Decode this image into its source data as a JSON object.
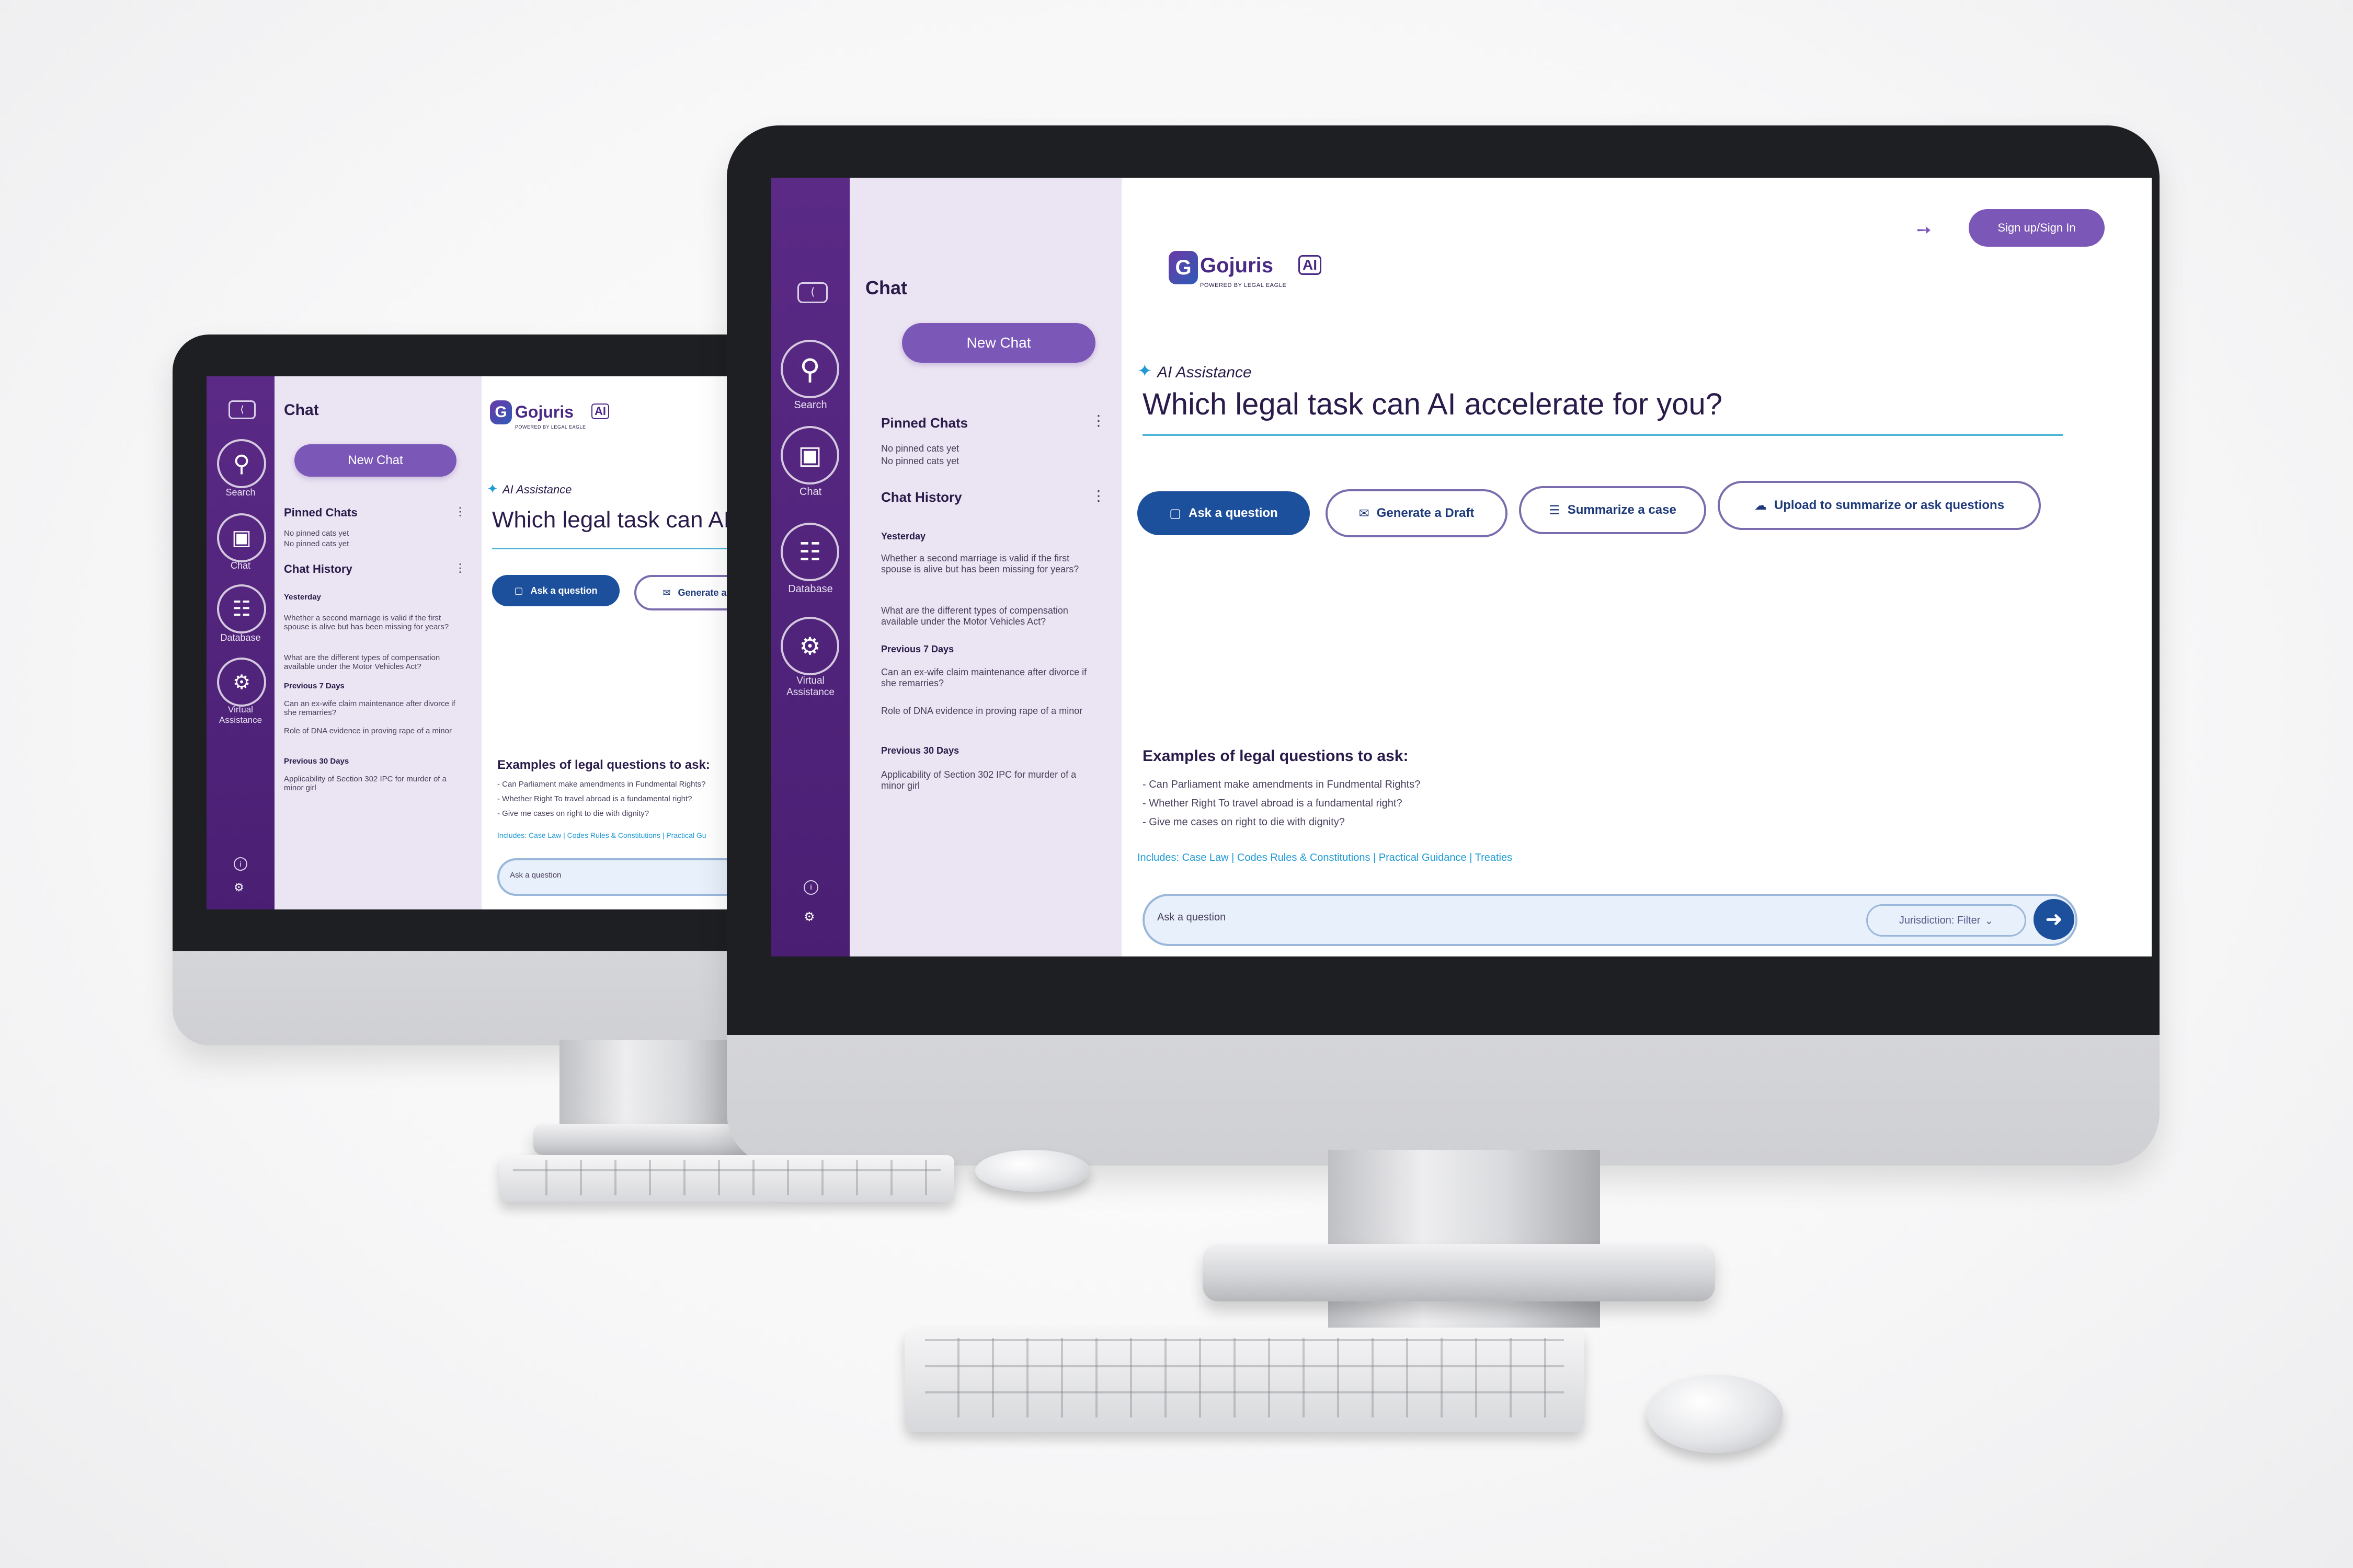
{
  "app": {
    "brand": "Gojuris",
    "brand_badge": "AI",
    "brand_sub": "POWERED BY LEGAL EAGLE",
    "signin": "Sign up/Sign In"
  },
  "rail": {
    "collapse": "⟨",
    "items": [
      {
        "label": "Search",
        "icon": "search-icon"
      },
      {
        "label": "Chat",
        "icon": "chat-icon"
      },
      {
        "label": "Database",
        "icon": "database-icon"
      },
      {
        "label": "Virtual Assistance",
        "icon": "virtual-assistant-icon"
      }
    ]
  },
  "sidebar": {
    "title": "Chat",
    "new_chat": "New Chat",
    "pinned_title": "Pinned Chats",
    "pinned_empty_1": "No pinned cats yet",
    "pinned_empty_2": "No pinned cats yet",
    "history_title": "Chat History",
    "groups": [
      {
        "heading": "Yesterday",
        "items": [
          "Whether a second marriage is valid if the first spouse is alive but has been missing for years?",
          "What are the different types of compensation available under the Motor Vehicles Act?"
        ]
      },
      {
        "heading": "Previous 7 Days",
        "items": [
          "Can an ex-wife claim maintenance after divorce if she remarries?",
          "Role of DNA evidence in proving rape of a minor"
        ]
      },
      {
        "heading": "Previous 30 Days",
        "items": [
          "Applicability of Section 302 IPC for murder of a minor girl"
        ]
      }
    ]
  },
  "main": {
    "assist_label": "AI Assistance",
    "headline": "Which legal task can AI accelerate for you?",
    "headline_cut": "Which legal task can AI ac",
    "actions": [
      "Ask a question",
      "Generate a Draft",
      "Summarize a case",
      "Upload to summarize or ask questions"
    ],
    "examples_title": "Examples of legal questions to ask:",
    "examples": [
      "Can Parliament make amendments in Fundmental Rights?",
      "Whether Right To travel abroad is a fundamental right?",
      "Give me cases on right to die with dignity?"
    ],
    "includes_label": "Includes:",
    "includes": [
      "Case Law",
      "Codes Rules & Constitutions",
      "Practical Guidance",
      "Treaties"
    ],
    "includes_cut": "Practical Gu",
    "ask_placeholder": "Ask a question",
    "jurisdiction": "Jurisdiction: Filter"
  },
  "colors": {
    "rail": "#4a1f73",
    "panel": "#ebe4f2",
    "accent": "#7b58b8",
    "primary": "#1c4f9c",
    "link": "#1e9ad6"
  }
}
